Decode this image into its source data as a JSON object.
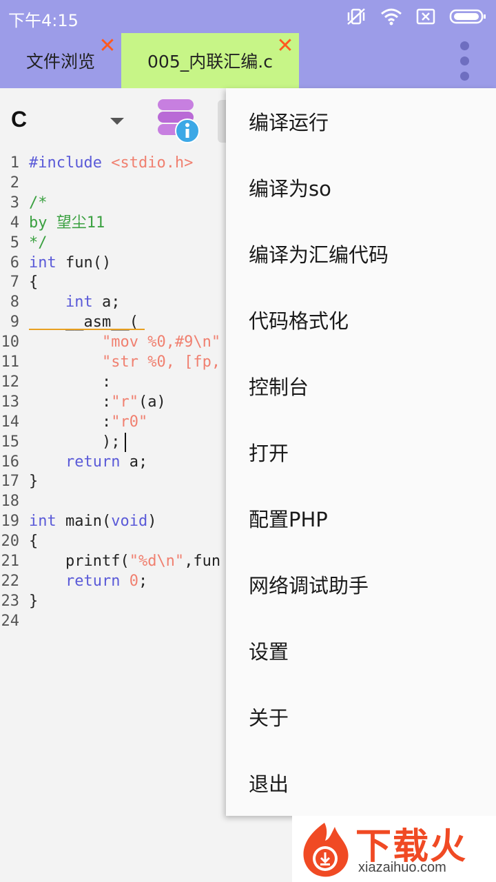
{
  "status_bar": {
    "time": "下午4:15",
    "icons": [
      "mute-vibrate-icon",
      "wifi-icon",
      "notification-x-icon",
      "battery-icon"
    ]
  },
  "tabs": [
    {
      "label": "文件浏览",
      "active": false
    },
    {
      "label": "005_内联汇编.c",
      "active": true
    }
  ],
  "toolbar": {
    "language": "C"
  },
  "editor": {
    "lines": [
      {
        "n": "1",
        "parts": [
          [
            "kw",
            "#include "
          ],
          [
            "str",
            "<stdio.h>"
          ]
        ]
      },
      {
        "n": "2",
        "parts": []
      },
      {
        "n": "3",
        "parts": [
          [
            "com",
            "/*"
          ]
        ]
      },
      {
        "n": "4",
        "parts": [
          [
            "com",
            "by 望尘11"
          ]
        ]
      },
      {
        "n": "5",
        "parts": [
          [
            "com",
            "*/"
          ]
        ]
      },
      {
        "n": "6",
        "parts": [
          [
            "kw",
            "int"
          ],
          [
            "txt",
            " fun()"
          ]
        ]
      },
      {
        "n": "7",
        "parts": [
          [
            "txt",
            "{"
          ]
        ]
      },
      {
        "n": "8",
        "parts": [
          [
            "txt",
            "    "
          ],
          [
            "kw",
            "int"
          ],
          [
            "txt",
            " a;"
          ]
        ]
      },
      {
        "n": "9",
        "parts": [
          [
            "txt",
            "    __asm__("
          ]
        ]
      },
      {
        "n": "10",
        "parts": [
          [
            "txt",
            "        "
          ],
          [
            "str",
            "\"mov %0,#9\\n\""
          ]
        ]
      },
      {
        "n": "11",
        "parts": [
          [
            "txt",
            "        "
          ],
          [
            "str",
            "\"str %0, [fp,"
          ]
        ]
      },
      {
        "n": "12",
        "parts": [
          [
            "txt",
            "        :"
          ]
        ]
      },
      {
        "n": "13",
        "parts": [
          [
            "txt",
            "        :"
          ],
          [
            "str",
            "\"r\""
          ],
          [
            "txt",
            "(a)"
          ]
        ]
      },
      {
        "n": "14",
        "parts": [
          [
            "txt",
            "        :"
          ],
          [
            "str",
            "\"r0\""
          ]
        ]
      },
      {
        "n": "15",
        "parts": [
          [
            "txt",
            "        );"
          ]
        ]
      },
      {
        "n": "16",
        "parts": [
          [
            "txt",
            "    "
          ],
          [
            "kw",
            "return"
          ],
          [
            "txt",
            " a;"
          ]
        ]
      },
      {
        "n": "17",
        "parts": [
          [
            "txt",
            "}"
          ]
        ]
      },
      {
        "n": "18",
        "parts": []
      },
      {
        "n": "19",
        "parts": [
          [
            "kw",
            "int"
          ],
          [
            "txt",
            " main("
          ],
          [
            "kw",
            "void"
          ],
          [
            "txt",
            ")"
          ]
        ]
      },
      {
        "n": "20",
        "parts": [
          [
            "txt",
            "{"
          ]
        ]
      },
      {
        "n": "21",
        "parts": [
          [
            "txt",
            "    printf("
          ],
          [
            "str",
            "\"%d\\n\""
          ],
          [
            "txt",
            ",fun"
          ]
        ]
      },
      {
        "n": "22",
        "parts": [
          [
            "txt",
            "    "
          ],
          [
            "kw",
            "return"
          ],
          [
            "txt",
            " "
          ],
          [
            "str",
            "0"
          ],
          [
            "txt",
            ";"
          ]
        ]
      },
      {
        "n": "23",
        "parts": [
          [
            "txt",
            "}"
          ]
        ]
      },
      {
        "n": "24",
        "parts": []
      }
    ]
  },
  "menu": {
    "items": [
      "编译运行",
      "编译为so",
      "编译为汇编代码",
      "代码格式化",
      "控制台",
      "打开",
      "配置PHP",
      "网络调试助手",
      "设置",
      "关于",
      "退出"
    ]
  },
  "watermark": {
    "title": "下载火",
    "subtitle": "xiazaihuo.com"
  },
  "colors": {
    "header": "#9c9ce8",
    "active_tab": "#c7f587",
    "close_x": "#ff5a1f",
    "keyword": "#5a5ad8",
    "string": "#f08070",
    "comment": "#3aa040"
  }
}
